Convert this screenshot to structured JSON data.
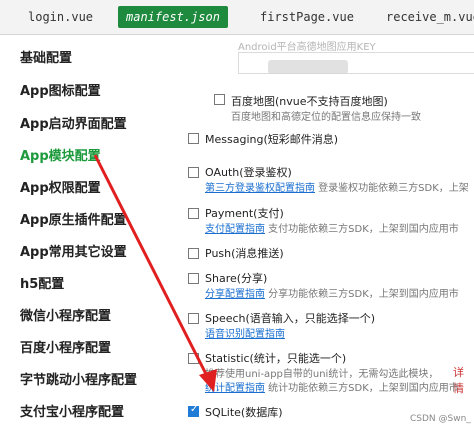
{
  "tabs": [
    {
      "label": "login.vue"
    },
    {
      "label": "manifest.json"
    },
    {
      "label": "firstPage.vue"
    },
    {
      "label": "receive_m.vue"
    }
  ],
  "sidebar": [
    {
      "label": "基础配置"
    },
    {
      "label": "App图标配置"
    },
    {
      "label": "App启动界面配置"
    },
    {
      "label": "App模块配置"
    },
    {
      "label": "App权限配置"
    },
    {
      "label": "App原生插件配置"
    },
    {
      "label": "App常用其它设置"
    },
    {
      "label": "h5配置"
    },
    {
      "label": "微信小程序配置"
    },
    {
      "label": "百度小程序配置"
    },
    {
      "label": "字节跳动小程序配置"
    },
    {
      "label": "支付宝小程序配置"
    }
  ],
  "header_blur": "Android平台高德地图应用KEY",
  "baidu": {
    "title": "百度地图(nvue不支持百度地图)",
    "desc": "百度地图和高德定位的配置信息应保持一致"
  },
  "modules": [
    {
      "title": "Messaging(短彩邮件消息)",
      "link": "",
      "desc": "",
      "checked": false
    },
    {
      "title": "OAuth(登录鉴权)",
      "link": "第三方登录鉴权配置指南",
      "desc": " 登录鉴权功能依赖三方SDK，上架",
      "checked": false
    },
    {
      "title": "Payment(支付)",
      "link": "支付配置指南",
      "desc": " 支付功能依赖三方SDK，上架到国内应用市",
      "checked": false
    },
    {
      "title": "Push(消息推送)",
      "link": "",
      "desc": "",
      "checked": false
    },
    {
      "title": "Share(分享)",
      "link": "分享配置指南",
      "desc": " 分享功能依赖三方SDK，上架到国内应用市",
      "checked": false
    },
    {
      "title": "Speech(语音输入，只能选择一个)",
      "link": "语音识别配置指南",
      "desc": "",
      "checked": false
    },
    {
      "title": "Statistic(统计，只能选一个)",
      "link": "",
      "desc": "推荐使用uni-app自带的uni统计，无需勾选此模块，",
      "checked": false
    },
    {
      "title": "",
      "link": "统计配置指南",
      "desc": " 统计功能依赖三方SDK，上架到国内应用市",
      "checked": false
    },
    {
      "title": "SQLite(数据库)",
      "link": "",
      "desc": "",
      "checked": true
    }
  ],
  "statistic_more": "详情",
  "watermark": "CSDN @Swn_",
  "colors": {
    "active_tab": "#1d8a3e",
    "active_sidebar": "#1c9a3c",
    "link": "#1a6fd0",
    "arrow": "#e02020",
    "checkbox_checked": "#1e7bd6"
  }
}
